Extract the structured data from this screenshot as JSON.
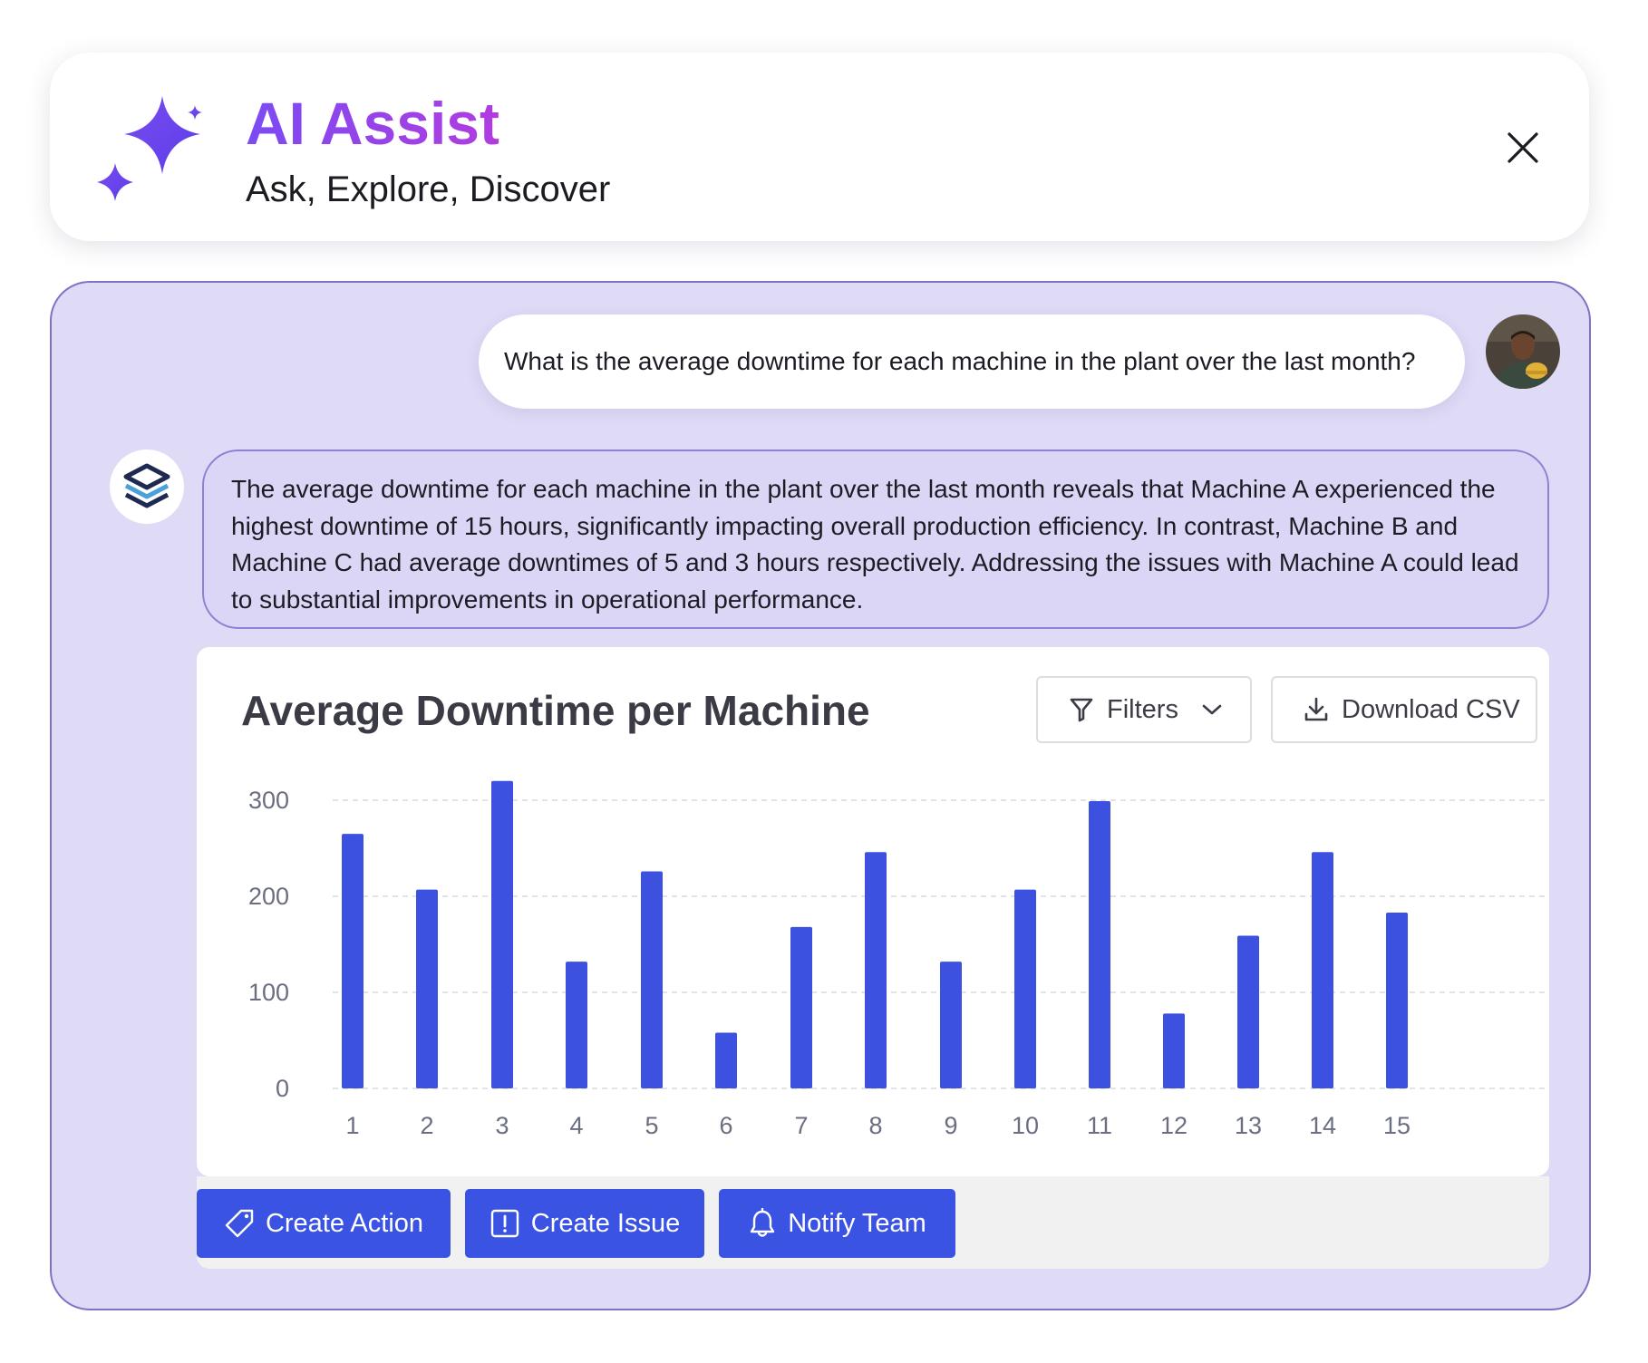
{
  "header": {
    "title": "AI Assist",
    "subtitle": "Ask, Explore, Discover",
    "logo_icon": "sparkle-icon",
    "close_icon": "close-icon",
    "accent_gradient": [
      "#7b4bf2",
      "#b13ce0"
    ]
  },
  "conversation": {
    "user_message": "What is the average downtime for each machine in the plant over the last month?",
    "assistant_message": "The average downtime for each machine in the plant over the last month reveals that Machine A experienced the highest downtime of 15 hours, significantly impacting overall production efficiency. In contrast, Machine B and Machine C had average downtimes of 5 and 3 hours respectively. Addressing the issues with Machine A could lead to substantial improvements in operational performance."
  },
  "chart_toolbar": {
    "filters_label": "Filters",
    "download_label": "Download CSV"
  },
  "chart_data": {
    "type": "bar",
    "title": "Average Downtime per Machine",
    "categories": [
      "1",
      "2",
      "3",
      "4",
      "5",
      "6",
      "7",
      "8",
      "9",
      "10",
      "11",
      "12",
      "13",
      "14",
      "15"
    ],
    "values": [
      265,
      207,
      320,
      132,
      226,
      58,
      168,
      246,
      132,
      207,
      299,
      78,
      159,
      246,
      183
    ],
    "ylim": [
      0,
      320
    ],
    "yticks": [
      0,
      100,
      200,
      300
    ],
    "grid": true,
    "bar_color": "#3d51e0"
  },
  "actions": {
    "create_action": "Create Action",
    "create_issue": "Create Issue",
    "notify_team": "Notify Team"
  },
  "colors": {
    "panel_bg": "#dfdaf6",
    "panel_border": "#7e72c5",
    "button_bg": "#3b53e2"
  }
}
